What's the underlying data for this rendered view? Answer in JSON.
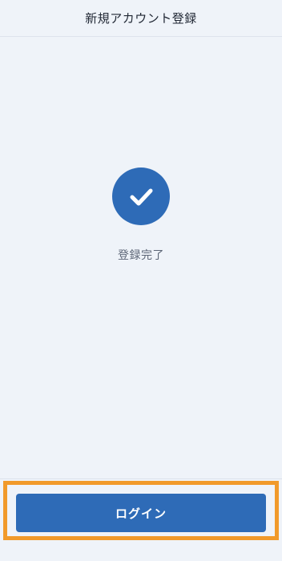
{
  "header": {
    "title": "新規アカウント登録"
  },
  "main": {
    "status_icon": "check-icon",
    "status_text": "登録完了"
  },
  "footer": {
    "login_label": "ログイン"
  },
  "colors": {
    "background": "#eff3f9",
    "accent": "#2e6bb7",
    "highlight": "#f19a2b"
  }
}
